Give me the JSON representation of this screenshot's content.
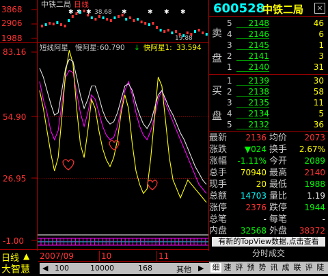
{
  "colors": {
    "up": "#ff3232",
    "down": "#00ff00",
    "accent": "#00ffff",
    "highlight": "#ffff00"
  },
  "mini_chart": {
    "title": "中铁二局",
    "period_label": "日线",
    "y_labels": [
      "3868",
      "2906",
      "1988"
    ],
    "high_mark": "38.68",
    "low_mark": "19.88"
  },
  "indicator_header": {
    "name": "短线阿星",
    "slow_label": "慢阿星:",
    "slow_value": "60.790",
    "slow_arrow": "↓",
    "fast_label": "快阿星1:",
    "fast_value": "33.594"
  },
  "y_axis": [
    "83.16",
    "54.90",
    "26.95",
    "-1.00"
  ],
  "chart_data": {
    "type": "line",
    "y_ticks": [
      83.16,
      54.9,
      26.95,
      -1.0
    ],
    "ylim": [
      -1.0,
      83.16
    ],
    "series": [
      {
        "name": "慢阿星",
        "color": "#ff00ff",
        "values": [
          70,
          62,
          56,
          48,
          44,
          48,
          60,
          72,
          75,
          74,
          65,
          56,
          50,
          56,
          64,
          62,
          56,
          50,
          46,
          44,
          45,
          50,
          58,
          66,
          70,
          64,
          56,
          50,
          46,
          44,
          48,
          54,
          62,
          66,
          60,
          56,
          52,
          48,
          44,
          40,
          36,
          32,
          28,
          24,
          22,
          20
        ]
      },
      {
        "name": "快阿星1",
        "color": "#ffff00",
        "values": [
          66,
          58,
          48,
          38,
          30,
          36,
          54,
          74,
          84,
          78,
          58,
          42,
          36,
          48,
          62,
          58,
          48,
          40,
          35,
          32,
          36,
          44,
          56,
          64,
          58,
          42,
          30,
          24,
          20,
          22,
          36,
          54,
          72,
          68,
          52,
          36,
          26,
          22,
          18,
          22,
          26,
          24,
          22,
          20,
          18,
          16
        ]
      },
      {
        "name": "白线",
        "color": "#e0e0e0",
        "values": [
          76,
          72,
          66,
          60,
          55,
          56,
          66,
          76,
          80,
          79,
          72,
          64,
          58,
          62,
          68,
          68,
          63,
          57,
          53,
          51,
          52,
          56,
          62,
          68,
          69,
          66,
          60,
          55,
          51,
          49,
          52,
          58,
          64,
          66,
          62,
          58,
          55,
          51,
          47,
          44,
          40,
          36,
          32,
          29,
          26,
          24
        ]
      }
    ]
  },
  "x_axis": {
    "year": "2007/09",
    "m1": "10",
    "m2": "11"
  },
  "status_bar": {
    "period": "日线",
    "brand": "大智慧",
    "tabs": [
      "100",
      "10000",
      "168",
      "其他"
    ]
  },
  "quote": {
    "code": "600528",
    "name": "中铁二局",
    "close": "☒",
    "sell_label": [
      "卖",
      "盘"
    ],
    "buy_label": [
      "买",
      "盘"
    ],
    "sells": [
      {
        "lvl": "5",
        "price": "2148",
        "vol": "46"
      },
      {
        "lvl": "4",
        "price": "2146",
        "vol": "6"
      },
      {
        "lvl": "3",
        "price": "2145",
        "vol": "1"
      },
      {
        "lvl": "2",
        "price": "2141",
        "vol": "3"
      },
      {
        "lvl": "1",
        "price": "2140",
        "vol": "31"
      }
    ],
    "buys": [
      {
        "lvl": "1",
        "price": "2139",
        "vol": "30"
      },
      {
        "lvl": "2",
        "price": "2138",
        "vol": "58"
      },
      {
        "lvl": "3",
        "price": "2135",
        "vol": "11"
      },
      {
        "lvl": "4",
        "price": "2134",
        "vol": "5"
      },
      {
        "lvl": "5",
        "price": "2132",
        "vol": "36"
      }
    ],
    "stats": [
      {
        "l1": "最新",
        "v1": "2136",
        "c1": "red",
        "l2": "均价",
        "v2": "2073",
        "c2": "red"
      },
      {
        "l1": "涨跌",
        "v1": "▼024",
        "c1": "green",
        "l2": "换手",
        "v2": "2.67%",
        "c2": "yellow"
      },
      {
        "l1": "涨幅",
        "v1": "-1.11%",
        "c1": "green",
        "l2": "今开",
        "v2": "2089",
        "c2": "green"
      },
      {
        "l1": "总手",
        "v1": "70940",
        "c1": "yellow",
        "l2": "最高",
        "v2": "2140",
        "c2": "red"
      },
      {
        "l1": "现手",
        "v1": "20",
        "c1": "yellow",
        "l2": "最低",
        "v2": "1988",
        "c2": "green"
      },
      {
        "l1": "总额",
        "v1": "14703",
        "c1": "cyan",
        "l2": "量比",
        "v2": "1.19",
        "c2": "white"
      },
      {
        "l1": "涨停",
        "v1": "2376",
        "c1": "red",
        "l2": "跌停",
        "v2": "1944",
        "c2": "green"
      },
      {
        "l1": "总笔",
        "v1": "-",
        "c1": "white",
        "l2": "每笔",
        "v2": "-",
        "c2": "white"
      },
      {
        "l1": "内盘",
        "v1": "32568",
        "c1": "green",
        "l2": "外盘",
        "v2": "38372",
        "c2": "red"
      }
    ],
    "news_button": "有新的TopView数据,点击查看",
    "tick_title": "分时成交",
    "panel_tabs": [
      "细",
      "速",
      "评",
      "预",
      "势",
      "讯",
      "成",
      "联",
      "评",
      "陡"
    ]
  }
}
